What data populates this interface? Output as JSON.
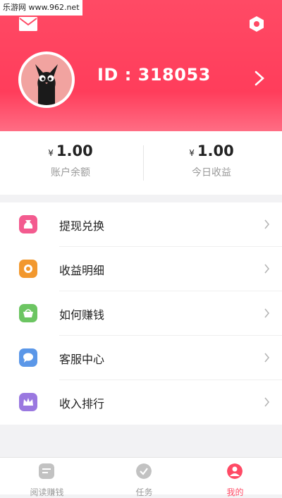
{
  "watermark": "乐游网 www.962.net",
  "header": {
    "user_id": "ID : 318053"
  },
  "stats": [
    {
      "currency": "¥",
      "value": "1.00",
      "label": "账户余额"
    },
    {
      "currency": "¥",
      "value": "1.00",
      "label": "今日收益"
    }
  ],
  "menu": [
    {
      "label": "提现兑换",
      "icon": "money-bag-icon",
      "color": "#f35b8f"
    },
    {
      "label": "收益明细",
      "icon": "coin-icon",
      "color": "#f2982e"
    },
    {
      "label": "如何赚钱",
      "icon": "basket-icon",
      "color": "#6cc562"
    },
    {
      "label": "客服中心",
      "icon": "chat-icon",
      "color": "#5b97e8"
    },
    {
      "label": "收入排行",
      "icon": "crown-icon",
      "color": "#9a78e0"
    }
  ],
  "tabs": [
    {
      "label": "阅读赚钱",
      "icon": "article-icon",
      "active": false
    },
    {
      "label": "任务",
      "icon": "check-circle-icon",
      "active": false
    },
    {
      "label": "我的",
      "icon": "profile-icon",
      "active": true
    }
  ],
  "colors": {
    "accent": "#ff4a65"
  }
}
